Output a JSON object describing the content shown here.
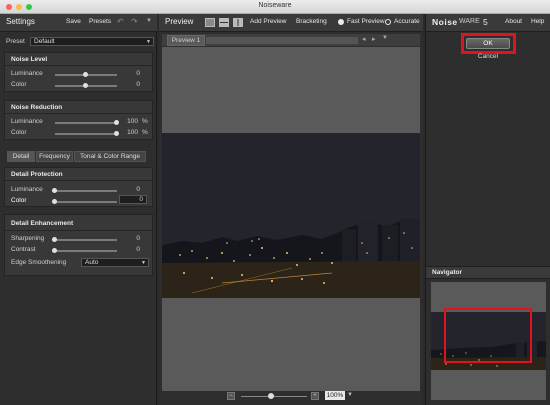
{
  "window": {
    "title": "Noiseware"
  },
  "settings": {
    "title": "Settings",
    "save_label": "Save",
    "presets_label": "Presets",
    "preset_label": "Preset",
    "preset_value": "Default",
    "noise_level": {
      "title": "Noise Level",
      "luminance_label": "Luminance",
      "luminance_value": "0",
      "color_label": "Color",
      "color_value": "0"
    },
    "noise_reduction": {
      "title": "Noise Reduction",
      "luminance_label": "Luminance",
      "luminance_value": "100",
      "luminance_unit": "%",
      "color_label": "Color",
      "color_value": "100",
      "color_unit": "%"
    },
    "tabs": [
      "Detail",
      "Frequency",
      "Tonal & Color Range"
    ],
    "detail_protection": {
      "title": "Detail Protection",
      "luminance_label": "Luminance",
      "luminance_value": "0",
      "color_label": "Color",
      "color_value": "0"
    },
    "detail_enhancement": {
      "title": "Detail Enhancement",
      "sharpening_label": "Sharpening",
      "sharpening_value": "0",
      "contrast_label": "Contrast",
      "contrast_value": "0",
      "edge_label": "Edge Smoothening",
      "edge_value": "Auto"
    }
  },
  "preview": {
    "title": "Preview",
    "add_preview_label": "Add Preview",
    "bracketing_label": "Bracketing",
    "fast_preview_label": "Fast Preview",
    "accurate_label": "Accurate",
    "tab_label": "Preview 1",
    "zoom_value": "100%",
    "zoom_minus": "−",
    "zoom_plus": "+"
  },
  "right": {
    "logo_bold": "Noise",
    "logo_rest": "ware",
    "version": "5",
    "about_label": "About",
    "help_label": "Help",
    "ok_label": "OK",
    "cancel_label": "Cancel",
    "navigator_title": "Navigator"
  }
}
